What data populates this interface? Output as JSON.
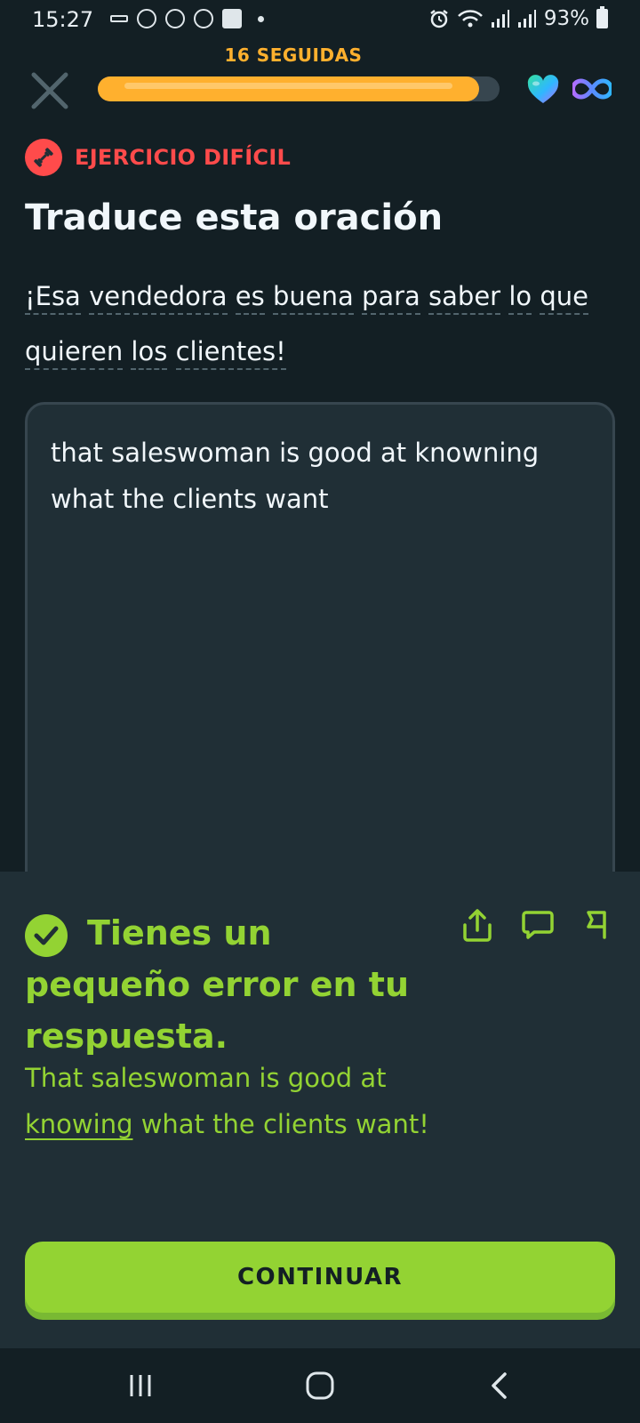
{
  "status_bar": {
    "time": "15:27",
    "battery": "93%"
  },
  "header": {
    "streak_label": "16 SEGUIDAS",
    "progress": 0.95,
    "icons": [
      "close-icon",
      "heart-icon",
      "infinity-icon"
    ]
  },
  "challenge": {
    "badge_label": "EJERCICIO DIFÍCIL",
    "title": "Traduce esta oración",
    "prompt_words": [
      "¡Esa",
      "vendedora",
      "es",
      "buena",
      "para",
      "saber",
      "lo",
      "que",
      "quieren",
      "los",
      "clientes!"
    ],
    "answer": "that saleswoman is good at knowning what the clients want"
  },
  "feedback": {
    "title": "Tienes un pequeño error en tu respuesta.",
    "correct_before": "That saleswoman is good at",
    "correct_highlight": "knowing",
    "correct_after": "what the clients want!",
    "continue_label": "CONTINUAR"
  },
  "colors": {
    "background": "#131f24",
    "panel": "#202f36",
    "streak": "#ffb02e",
    "hard": "#ff4b4b",
    "success": "#93d333"
  }
}
